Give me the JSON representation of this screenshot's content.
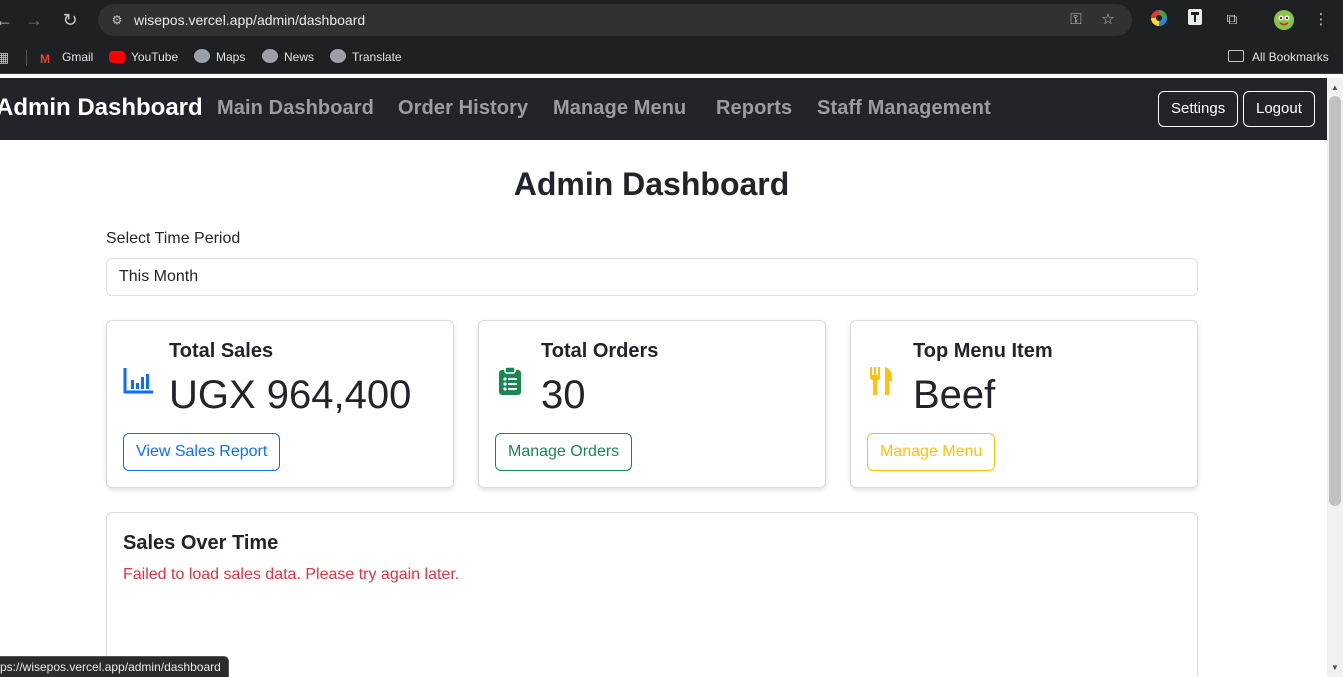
{
  "browser": {
    "url": "wisepos.vercel.app/admin/dashboard",
    "bookmarks": [
      {
        "label": "Gmail",
        "color": "#ea4335"
      },
      {
        "label": "YouTube",
        "color": "#ff0000"
      },
      {
        "label": "Maps",
        "color": "#9aa0a6"
      },
      {
        "label": "News",
        "color": "#9aa0a6"
      },
      {
        "label": "Translate",
        "color": "#9aa0a6"
      }
    ],
    "all_bookmarks": "All Bookmarks",
    "status_url": "ps://wisepos.vercel.app/admin/dashboard"
  },
  "navbar": {
    "brand": "Admin Dashboard",
    "links": [
      "Main Dashboard",
      "Order History",
      "Manage Menu",
      "Reports",
      "Staff Management"
    ],
    "settings": "Settings",
    "logout": "Logout"
  },
  "main": {
    "title": "Admin Dashboard",
    "period_label": "Select Time Period",
    "period_value": "This Month",
    "cards": [
      {
        "title": "Total Sales",
        "value": "UGX 964,400",
        "button": "View Sales Report",
        "color": "#0d6efd",
        "icon": "bar-chart-icon"
      },
      {
        "title": "Total Orders",
        "value": "30",
        "button": "Manage Orders",
        "color": "#198754",
        "icon": "clipboard-list-icon"
      },
      {
        "title": "Top Menu Item",
        "value": "Beef",
        "button": "Manage Menu",
        "color": "#ffc107",
        "icon": "utensils-icon"
      }
    ],
    "sales_panel": {
      "title": "Sales Over Time",
      "error": "Failed to load sales data. Please try again later.",
      "error_color": "#dc3545"
    }
  }
}
